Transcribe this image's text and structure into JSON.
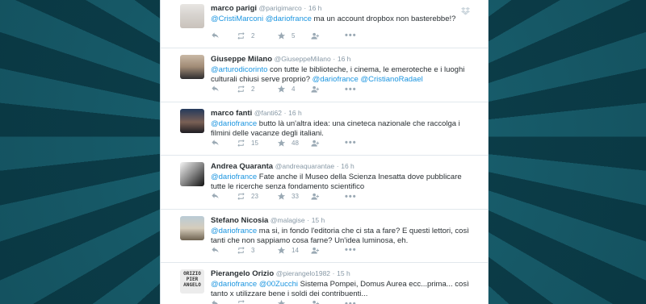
{
  "tweets": [
    {
      "name": "marco parigi",
      "handle": "@parigimarco",
      "time": "16 h",
      "avatar_icon": "avatar-glasses-man",
      "text": [
        {
          "t": "@CristiMarconi",
          "m": true
        },
        {
          "t": " ",
          "m": false
        },
        {
          "t": "@dariofrance",
          "m": true
        },
        {
          "t": " ma un account dropbox non basterebbe!?",
          "m": false
        }
      ],
      "retweets": "2",
      "favorites": "5"
    },
    {
      "name": "Giuseppe Milano",
      "handle": "@GiuseppeMilano",
      "time": "16 h",
      "avatar_icon": "avatar-man-suit",
      "text": [
        {
          "t": "@arturodicorinto",
          "m": true
        },
        {
          "t": " con tutte le biblioteche, i cinema, le emeroteche e i luoghi culturali chiusi serve proprio? ",
          "m": false
        },
        {
          "t": "@dariofrance",
          "m": true
        },
        {
          "t": " ",
          "m": false
        },
        {
          "t": "@CristianoRadael",
          "m": true
        }
      ],
      "retweets": "2",
      "favorites": "4"
    },
    {
      "name": "marco fanti",
      "handle": "@fanti62",
      "time": "16 h",
      "avatar_icon": "avatar-man-stage",
      "text": [
        {
          "t": "@dariofrance",
          "m": true
        },
        {
          "t": " butto là un'altra idea: una cineteca nazionale che raccolga i filmini delle vacanze degli italiani.",
          "m": false
        }
      ],
      "retweets": "15",
      "favorites": "48"
    },
    {
      "name": "Andrea Quaranta",
      "handle": "@andreaquarantae",
      "time": "16 h",
      "avatar_icon": "avatar-bw-portrait",
      "text": [
        {
          "t": "@dariofrance",
          "m": true
        },
        {
          "t": " Fate anche il Museo della Scienza Inesatta dove pubblicare tutte le ricerche senza fondamento scientifico",
          "m": false
        }
      ],
      "retweets": "23",
      "favorites": "33"
    },
    {
      "name": "Stefano Nicosia",
      "handle": "@malagise",
      "time": "15 h",
      "avatar_icon": "avatar-outdoor",
      "text": [
        {
          "t": "@dariofrance",
          "m": true
        },
        {
          "t": " ma si, in fondo l'editoria che ci sta a fare? E questi lettori, così tanti che non sappiamo cosa farne? Un'idea luminosa, eh.",
          "m": false
        }
      ],
      "retweets": "3",
      "favorites": "14"
    },
    {
      "name": "Pierangelo Orizio",
      "handle": "@pierangelo1982",
      "time": "15 h",
      "avatar_icon": "avatar-text-logo",
      "avatar_lines": [
        "ORIZIO",
        "PIER",
        "ANGELO"
      ],
      "text": [
        {
          "t": "@dariofrance",
          "m": true
        },
        {
          "t": " ",
          "m": false
        },
        {
          "t": "@00Zucchi",
          "m": true
        },
        {
          "t": " Sistema Pompei, Domus Aurea ecc...prima... così tanto x utilizzare bene i soldi dei contribuenti...",
          "m": false
        }
      ],
      "retweets": "",
      "favorites": ""
    }
  ],
  "colors": {
    "link": "#1b95e0",
    "text": "#292f33",
    "muted": "#8899a6",
    "background": "#0f4a57"
  }
}
